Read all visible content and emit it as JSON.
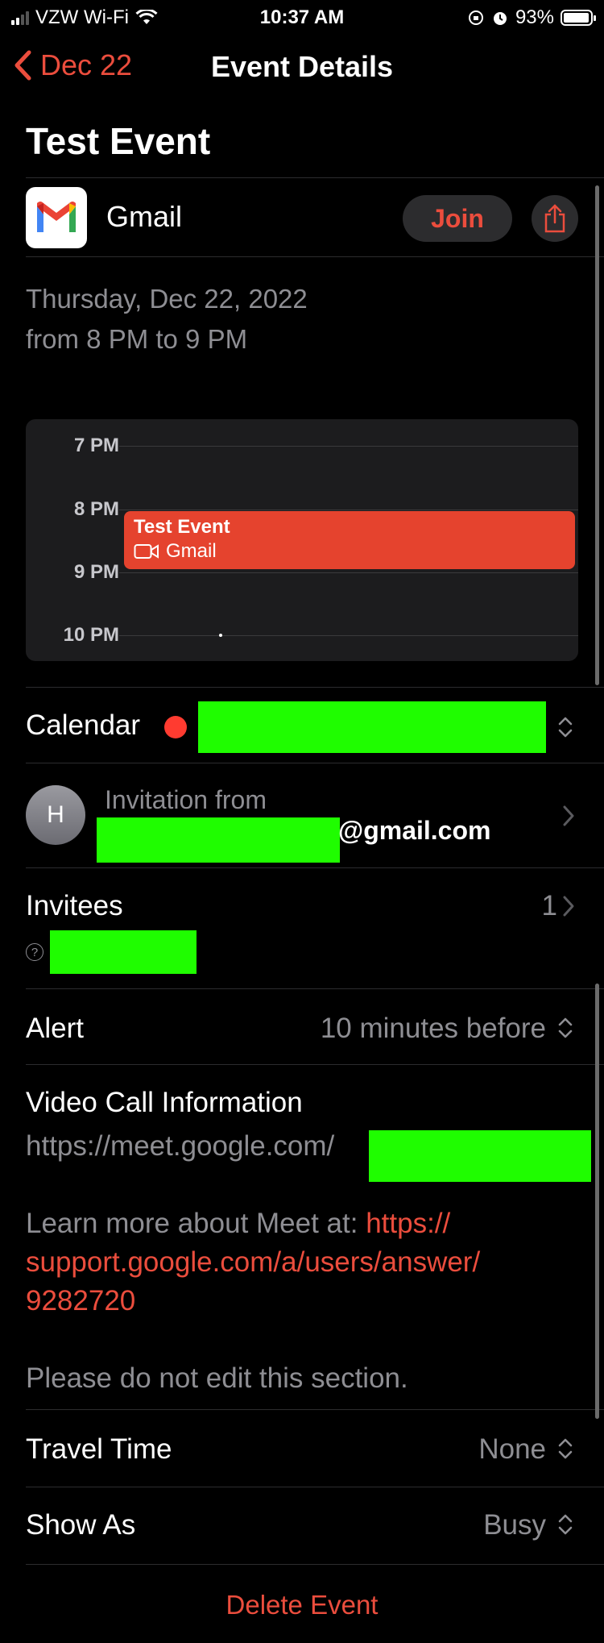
{
  "status_bar": {
    "carrier": "VZW Wi-Fi",
    "time": "10:37 AM",
    "battery": "93%",
    "battery_level": 0.93
  },
  "nav": {
    "back_label": "Dec 22",
    "title": "Event Details"
  },
  "event": {
    "title": "Test Event",
    "conference_app": "Gmail",
    "join_label": "Join",
    "date": "Thursday, Dec 22, 2022",
    "time_range": "from 8 PM to 9 PM"
  },
  "timeline": {
    "hours": [
      "7 PM",
      "8 PM",
      "9 PM",
      "10 PM"
    ],
    "event_title": "Test Event",
    "event_sub": "Gmail"
  },
  "calendar_row": {
    "label": "Calendar",
    "color": "#ff3b30"
  },
  "invitation": {
    "avatar_initial": "H",
    "label": "Invitation from",
    "email_suffix": "@gmail.com"
  },
  "invitees": {
    "label": "Invitees",
    "count": "1"
  },
  "alert": {
    "label": "Alert",
    "value": "10 minutes before"
  },
  "video_call": {
    "heading": "Video Call Information",
    "link": "https://meet.google.com/",
    "learn_more_prefix": "Learn more about Meet at: ",
    "learn_more_link_1": "https://",
    "learn_more_link_2": "support.google.com/a/users/answer/",
    "learn_more_link_3": "9282720",
    "note": "Please do not edit this section."
  },
  "travel_time": {
    "label": "Travel Time",
    "value": "None"
  },
  "show_as": {
    "label": "Show As",
    "value": "Busy"
  },
  "delete_label": "Delete Event",
  "colors": {
    "accent": "#eb4d3d",
    "event_block": "#e5432e",
    "redaction": "#1ffd00"
  }
}
